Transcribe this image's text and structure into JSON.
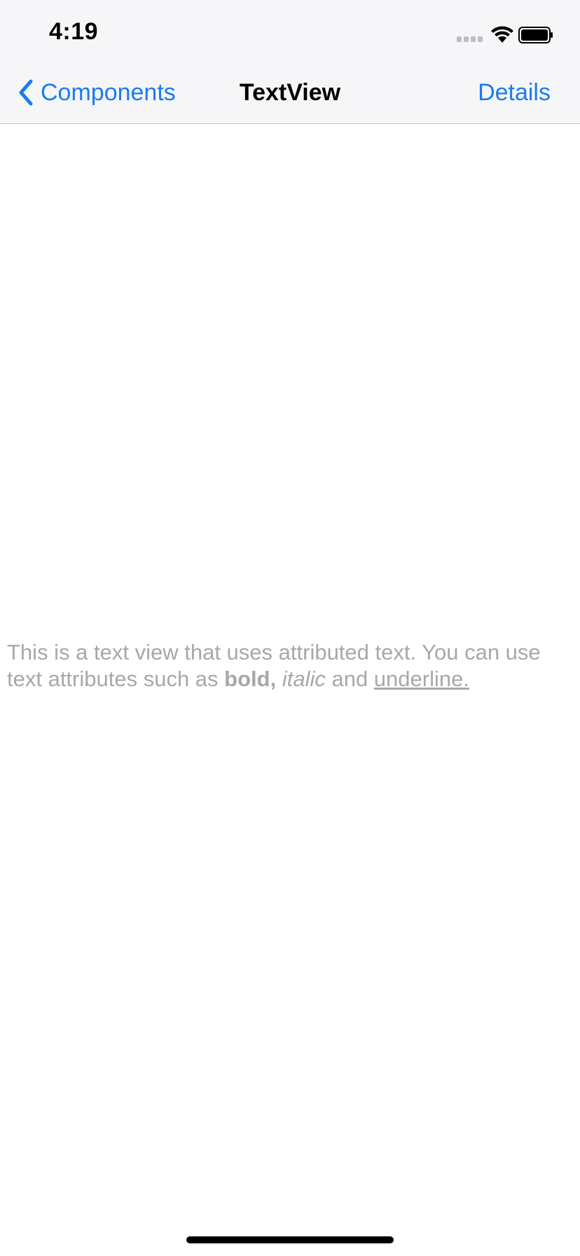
{
  "status_bar": {
    "time": "4:19"
  },
  "nav": {
    "back_label": "Components",
    "title": "TextView",
    "right_label": "Details"
  },
  "text_view": {
    "part1": "This is a text view that uses attributed text. You can use text attributes such as ",
    "bold": "bold,",
    "space1": " ",
    "italic": "italic",
    "and": " and ",
    "underline": "underline."
  },
  "colors": {
    "accent": "#1a7cf0",
    "text_placeholder": "#a8a8ac",
    "nav_bg": "#f6f6f8"
  },
  "icons": {
    "back": "chevron-left-icon",
    "wifi": "wifi-icon",
    "battery": "battery-icon",
    "signal": "signal-icon"
  }
}
